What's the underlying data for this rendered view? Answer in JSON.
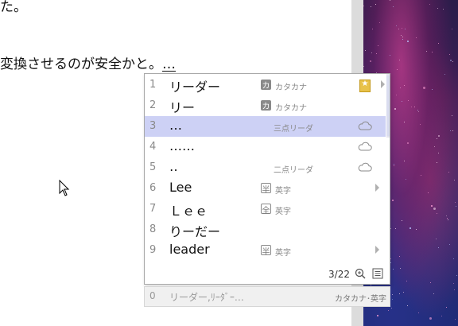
{
  "document": {
    "line1": "た。",
    "line2_prefix": "変換させるのが安全かと。",
    "line2_composing": "…"
  },
  "candidates": {
    "items": [
      {
        "num": "1",
        "text": "リーダー",
        "badge": "カ",
        "annotation": "カタカナ",
        "icon": "star-icon",
        "selected": false
      },
      {
        "num": "2",
        "text": "リー",
        "badge": "カ",
        "annotation": "カタカナ",
        "icon": "",
        "selected": false
      },
      {
        "num": "3",
        "text": "…",
        "badge": "",
        "annotation": "",
        "note": "三点リーダ",
        "icon": "cloud-icon",
        "selected": true
      },
      {
        "num": "4",
        "text": "……",
        "badge": "",
        "annotation": "",
        "note": "",
        "icon": "cloud-icon",
        "selected": false
      },
      {
        "num": "5",
        "text": "‥",
        "badge": "",
        "annotation": "",
        "note": "二点リーダ",
        "icon": "cloud-icon",
        "selected": false
      },
      {
        "num": "6",
        "text": "Lee",
        "badge": "半",
        "annotation": "英字",
        "icon": "arrow",
        "selected": false
      },
      {
        "num": "7",
        "text": "Ｌｅｅ",
        "badge": "全",
        "annotation": "英字",
        "icon": "",
        "selected": false
      },
      {
        "num": "8",
        "text": "りーだー",
        "badge": "",
        "annotation": "",
        "icon": "",
        "selected": false
      },
      {
        "num": "9",
        "text": "leader",
        "badge": "半",
        "annotation": "英字",
        "icon": "arrow",
        "selected": false
      }
    ],
    "page_count": "3/22",
    "star_badge": "★"
  },
  "history": {
    "num": "0",
    "text": "リーダー,ﾘｰﾀﾞｰ…",
    "tag": "カタカナ･英字"
  },
  "colors": {
    "selection": "#cdd1f5",
    "border": "#a9a9a9"
  }
}
